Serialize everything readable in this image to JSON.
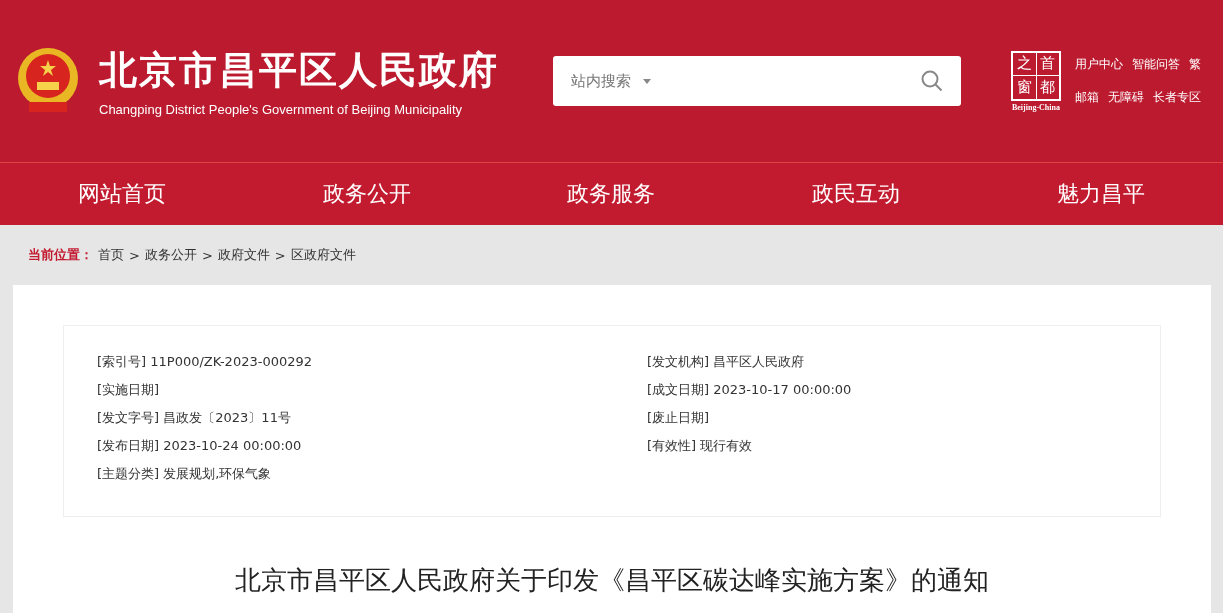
{
  "header": {
    "title": "北京市昌平区人民政府",
    "subtitle": "Changping District People's Government of Beijing Municipality",
    "search": {
      "scope": "站内搜索"
    },
    "badge": {
      "chars": [
        "之",
        "首",
        "窗",
        "都"
      ],
      "caption": "Beijing-China"
    },
    "links": [
      [
        "用户中心",
        "智能问答",
        "繁"
      ],
      [
        "邮箱",
        "无障碍",
        "长者专区"
      ]
    ]
  },
  "nav": [
    {
      "label": "网站首页",
      "selected": false
    },
    {
      "label": "政务公开",
      "selected": false
    },
    {
      "label": "政务服务",
      "selected": false
    },
    {
      "label": "政民互动",
      "selected": false
    },
    {
      "label": "魅力昌平",
      "selected": false
    }
  ],
  "breadcrumb": {
    "label": "当前位置：",
    "items": [
      "首页",
      "政务公开",
      "政府文件",
      "区政府文件"
    ],
    "separator": ">"
  },
  "meta": {
    "left": [
      {
        "label": "[索引号]",
        "value": "11P000/ZK-2023-000292"
      },
      {
        "label": "[实施日期]"
      },
      {
        "label": "[发文字号]",
        "value": "昌政发〔2023〕11号"
      },
      {
        "label": "[发布日期]",
        "value": "2023-10-24 00:00:00"
      },
      {
        "label": "[主题分类]",
        "value": "发展规划,环保气象"
      }
    ],
    "right": [
      {
        "label": "[发文机构]",
        "value": "昌平区人民政府"
      },
      {
        "label": "[成文日期]",
        "value": "2023-10-17 00:00:00"
      },
      {
        "label": "[废止日期]"
      },
      {
        "label": "[有效性]",
        "value": "现行有效"
      }
    ]
  },
  "article_title": "北京市昌平区人民政府关于印发《昌平区碳达峰实施方案》的通知"
}
